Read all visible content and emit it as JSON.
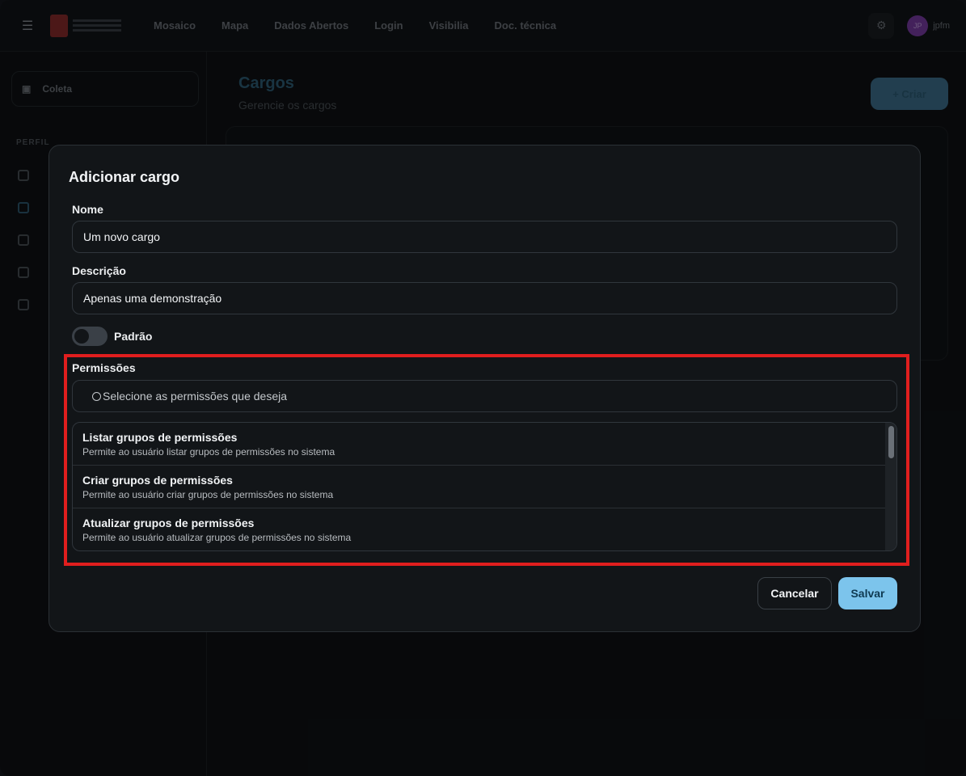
{
  "topbar": {
    "nav": [
      "Mosaico",
      "Mapa",
      "Dados Abertos",
      "Login",
      "Visibilia",
      "Doc. técnica"
    ],
    "user_initials": "JP",
    "user_name": "jpfm"
  },
  "sidebar": {
    "org_name": "Coleta",
    "section_label": "PERFIL"
  },
  "main": {
    "title": "Cargos",
    "subtitle": "Gerencie os cargos",
    "create_label": "+ Criar"
  },
  "modal": {
    "title": "Adicionar cargo",
    "name_label": "Nome",
    "name_value": "Um novo cargo",
    "description_label": "Descrição",
    "description_value": "Apenas uma demonstração",
    "default_toggle_label": "Padrão",
    "default_toggle_on": false,
    "permissions_label": "Permissões",
    "permissions_placeholder": "Selecione as permissões que deseja",
    "permissions": [
      {
        "name": "Listar grupos de permissões",
        "description": "Permite ao usuário listar grupos de permissões no sistema"
      },
      {
        "name": "Criar grupos de permissões",
        "description": "Permite ao usuário criar grupos de permissões no sistema"
      },
      {
        "name": "Atualizar grupos de permissões",
        "description": "Permite ao usuário atualizar grupos de permissões no sistema"
      }
    ],
    "cancel_label": "Cancelar",
    "save_label": "Salvar"
  },
  "colors": {
    "accent": "#7cc4ec",
    "highlight": "#e01e1e"
  }
}
